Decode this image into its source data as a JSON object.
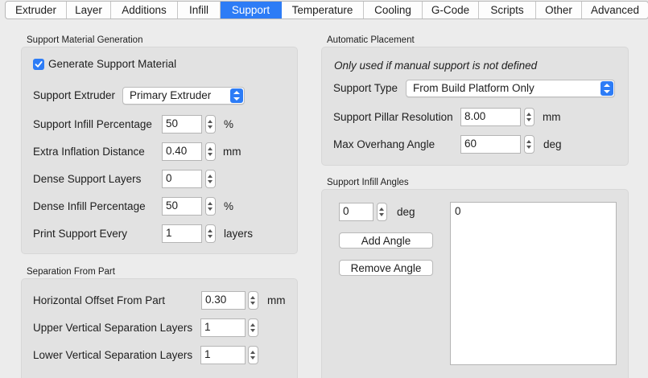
{
  "tabs": [
    {
      "label": "Extruder",
      "active": false
    },
    {
      "label": "Layer",
      "active": false
    },
    {
      "label": "Additions",
      "active": false
    },
    {
      "label": "Infill",
      "active": false
    },
    {
      "label": "Support",
      "active": true
    },
    {
      "label": "Temperature",
      "active": false
    },
    {
      "label": "Cooling",
      "active": false
    },
    {
      "label": "G-Code",
      "active": false
    },
    {
      "label": "Scripts",
      "active": false
    },
    {
      "label": "Other",
      "active": false
    },
    {
      "label": "Advanced",
      "active": false
    }
  ],
  "support_material_generation": {
    "title": "Support Material Generation",
    "generate_checkbox": {
      "label": "Generate Support Material",
      "checked": true
    },
    "support_extruder": {
      "label": "Support Extruder",
      "value": "Primary Extruder"
    },
    "support_infill_percentage": {
      "label": "Support Infill Percentage",
      "value": "50",
      "unit": "%"
    },
    "extra_inflation_distance": {
      "label": "Extra Inflation Distance",
      "value": "0.40",
      "unit": "mm"
    },
    "dense_support_layers": {
      "label": "Dense Support Layers",
      "value": "0"
    },
    "dense_infill_percentage": {
      "label": "Dense Infill Percentage",
      "value": "50",
      "unit": "%"
    },
    "print_support_every": {
      "label": "Print Support Every",
      "value": "1",
      "unit": "layers"
    }
  },
  "separation_from_part": {
    "title": "Separation From Part",
    "horizontal_offset": {
      "label": "Horizontal Offset From Part",
      "value": "0.30",
      "unit": "mm"
    },
    "upper_vertical_separation": {
      "label": "Upper Vertical Separation Layers",
      "value": "1"
    },
    "lower_vertical_separation": {
      "label": "Lower Vertical Separation Layers",
      "value": "1"
    }
  },
  "automatic_placement": {
    "title": "Automatic Placement",
    "note": "Only used if manual support is not defined",
    "support_type": {
      "label": "Support Type",
      "value": "From Build Platform Only"
    },
    "pillar_resolution": {
      "label": "Support Pillar Resolution",
      "value": "8.00",
      "unit": "mm"
    },
    "max_overhang_angle": {
      "label": "Max Overhang Angle",
      "value": "60",
      "unit": "deg"
    }
  },
  "support_infill_angles": {
    "title": "Support Infill Angles",
    "angle_input": {
      "value": "0",
      "unit": "deg"
    },
    "add_button": "Add Angle",
    "remove_button": "Remove Angle",
    "angles_list": [
      "0"
    ]
  },
  "colors": {
    "accent": "#2d7cf6",
    "window_bg": "#ececec",
    "group_bg": "#e2e2e2"
  }
}
